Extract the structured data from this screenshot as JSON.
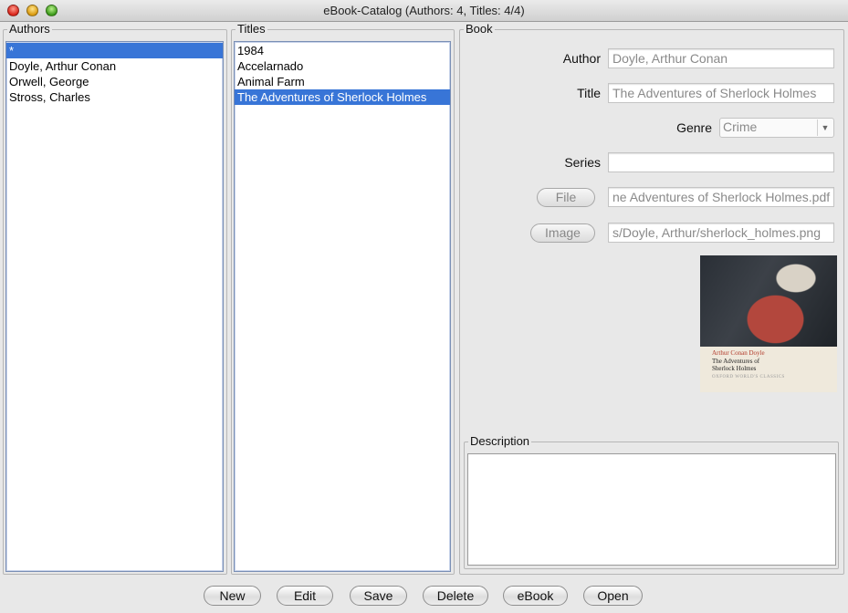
{
  "window": {
    "title": "eBook-Catalog (Authors: 4, Titles: 4/4)"
  },
  "authors": {
    "legend": "Authors",
    "items": [
      "*",
      "Doyle, Arthur Conan",
      "Orwell, George",
      "Stross, Charles"
    ],
    "selected_index": 0
  },
  "titles": {
    "legend": "Titles",
    "items": [
      "1984",
      "Accelarnado",
      "Animal Farm",
      "The Adventures of Sherlock Holmes"
    ],
    "selected_index": 3
  },
  "book": {
    "legend": "Book",
    "author_label": "Author",
    "author_value": "Doyle, Arthur Conan",
    "title_label": "Title",
    "title_value": "The Adventures of Sherlock Holmes",
    "genre_label": "Genre",
    "genre_value": "Crime",
    "series_label": "Series",
    "series_value": "",
    "file_button": "File",
    "file_value": "ne Adventures of Sherlock Holmes.pdf",
    "image_button": "Image",
    "image_value": "s/Doyle, Arthur/sherlock_holmes.png",
    "cover": {
      "author": "Arthur Conan Doyle",
      "title_line1": "The Adventures of",
      "title_line2": "Sherlock Holmes",
      "series": "OXFORD WORLD'S CLASSICS"
    }
  },
  "description": {
    "legend": "Description",
    "value": ""
  },
  "buttons": {
    "new": "New",
    "edit": "Edit",
    "save": "Save",
    "delete": "Delete",
    "ebook": "eBook",
    "open": "Open"
  },
  "colors": {
    "selection": "#3875d7",
    "window_bg": "#e8e8e8"
  }
}
